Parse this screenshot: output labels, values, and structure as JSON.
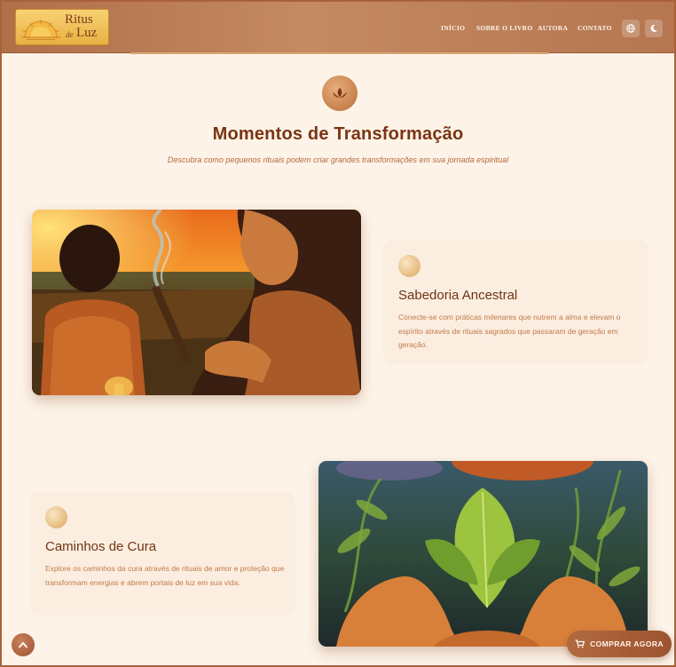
{
  "logo": {
    "line1": "Ritus",
    "de": "de",
    "luz": "Luz"
  },
  "nav": {
    "items": [
      {
        "label": "INÍCIO"
      },
      {
        "label": "SOBRE O LIVRO"
      },
      {
        "label": "AUTORA"
      },
      {
        "label": "CONTATO"
      }
    ],
    "language_icon": "globe-icon",
    "theme_icon": "moon-icon"
  },
  "hero": {
    "icon": "lotus-icon",
    "title": "Momentos de Transformação",
    "subtitle": "Descubra como pequenos rituais podem criar grandes transformações em sua jornada espiritual"
  },
  "features": [
    {
      "title": "Sabedoria Ancestral",
      "text": "Conecte-se com práticas milenares que nutrem a alma e elevam o espírito através de rituais sagrados que passaram de geração em geração."
    },
    {
      "title": "Caminhos de Cura",
      "text": "Explore os caminhos da cura através de rituais de amor e proteção que transformam energias e abrem portais de luz em sua vida."
    }
  ],
  "buttons": {
    "buy": "COMPRAR AGORA",
    "buy_icon": "cart-icon",
    "scroll_icon": "chevron-up-icon"
  },
  "colors": {
    "accent": "#7a3412",
    "header": "#b57650",
    "background": "#fdf3e8"
  }
}
